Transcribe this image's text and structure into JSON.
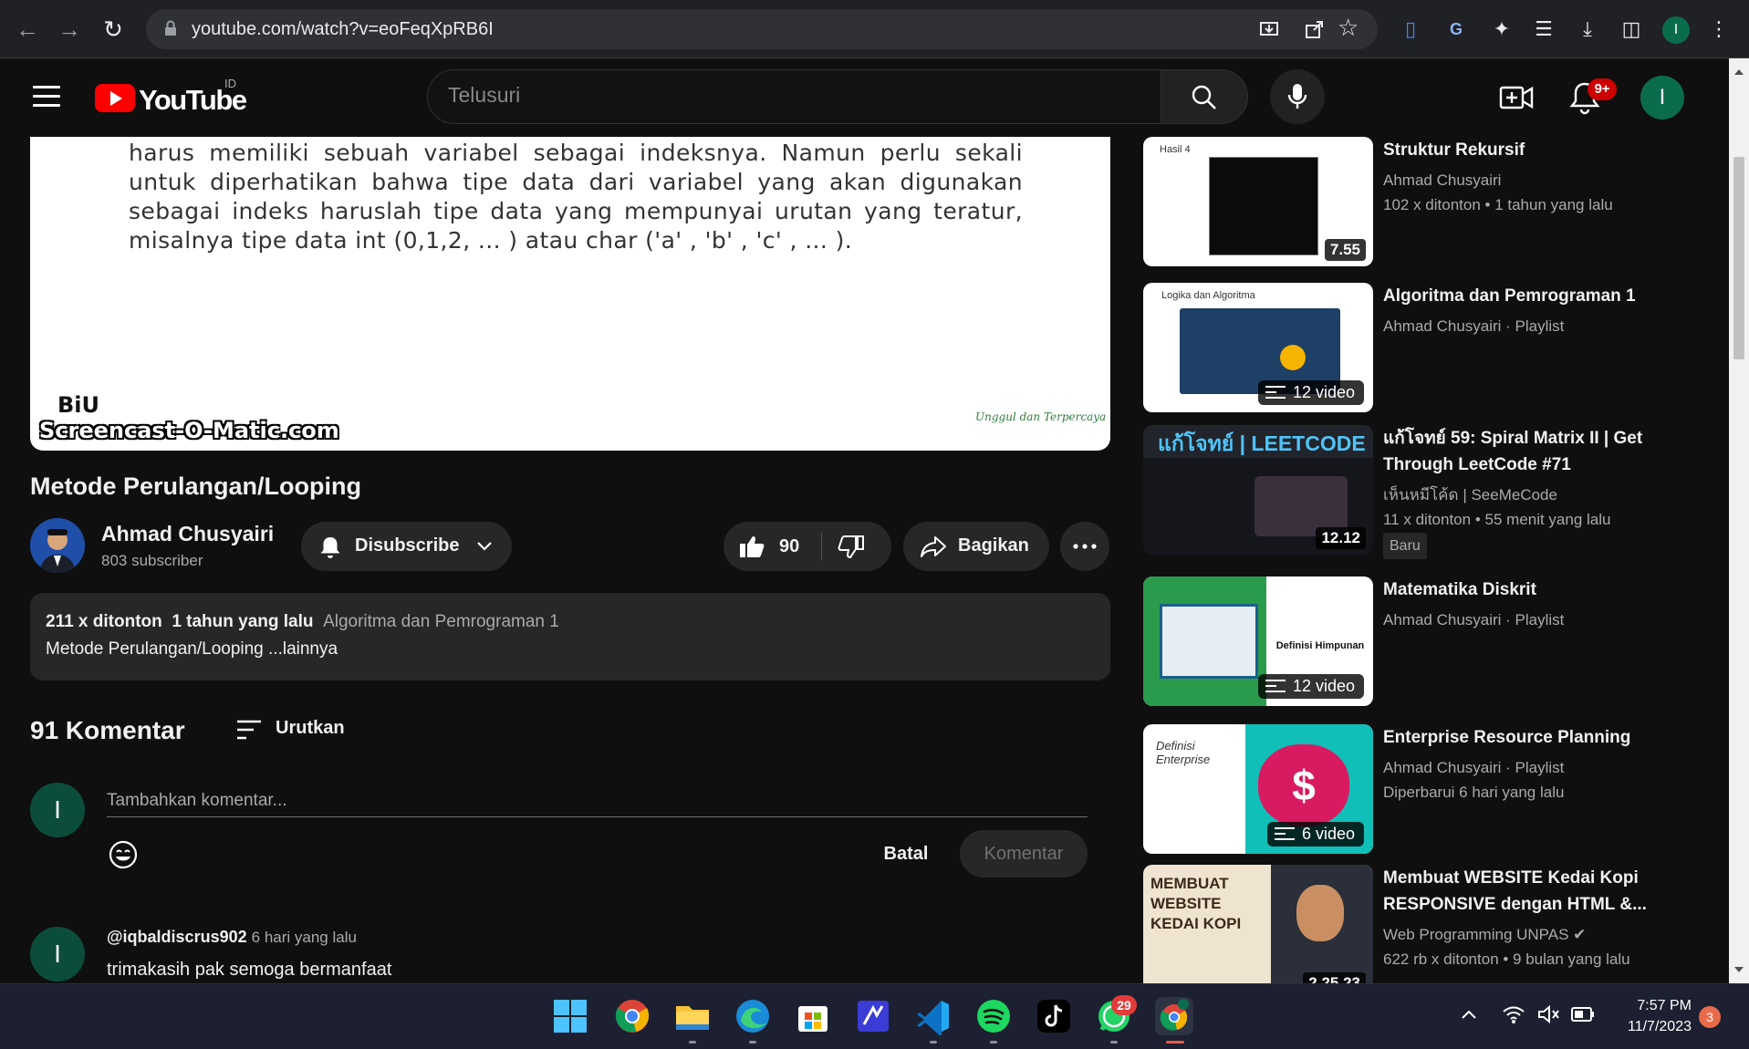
{
  "browser": {
    "url": "youtube.com/watch?v=eoFeqXpRB6I",
    "profile_initial": "I"
  },
  "header": {
    "logo_text": "YouTube",
    "region_code": "ID",
    "search_placeholder": "Telusuri",
    "notification_count": "9+",
    "avatar_initial": "I"
  },
  "video": {
    "slide_text": "harus memiliki sebuah variabel sebagai indeksnya. Namun perlu sekali untuk diperhatikan bahwa tipe data dari variabel yang akan digunakan sebagai indeks haruslah tipe data yang mempunyai urutan yang teratur, misalnya tipe data int (0,1,2, ... ) atau char ('a' , 'b' , 'c' , ... ).",
    "watermark_logo": "BiU",
    "watermark": "Screencast-O-Matic.com",
    "slide_logo": "Unggul dan Terpercaya",
    "title": "Metode Perulangan/Looping"
  },
  "channel": {
    "name": "Ahmad Chusyairi",
    "subscribers": "803 subscriber",
    "subscribe_label": "Disubscribe"
  },
  "actions": {
    "like_count": "90",
    "share_label": "Bagikan"
  },
  "description": {
    "views": "211 x ditonton",
    "age": "1 tahun yang lalu",
    "playlist": "Algoritma dan Pemrograman 1",
    "summary": "Metode Perulangan/Looping ...lainnya"
  },
  "comments": {
    "count_label": "91 Komentar",
    "sort_label": "Urutkan",
    "user_initial": "I",
    "input_placeholder": "Tambahkan komentar...",
    "cancel_label": "Batal",
    "submit_label": "Komentar",
    "items": [
      {
        "author": "@iqbaldiscrus902",
        "time": "6 hari yang lalu",
        "text": "trimakasih pak semoga bermanfaat",
        "initial": "I"
      }
    ]
  },
  "recommendations": [
    {
      "title": "Struktur Rekursif",
      "channel": "Ahmad Chusyairi",
      "meta": "102 x ditonton  • 1 tahun yang lalu",
      "duration": "7.55",
      "thumb_label": "Hasil 4"
    },
    {
      "title": "Algoritma dan Pemrograman 1",
      "channel": "Ahmad Chusyairi · Playlist",
      "badge": "12 video",
      "thumb_label": "Logika dan Algoritma"
    },
    {
      "title": "แก้โจทย์ 59: Spiral Matrix II | Get Through LeetCode #71",
      "channel": "เห็นหมีโค้ด | SeeMeCode",
      "meta": "11 x ditonton  • 55 menit yang lalu",
      "new_badge": "Baru",
      "duration": "12.12",
      "thumb_label": "แก้โจทย์ | LEETCODE"
    },
    {
      "title": "Matematika Diskrit",
      "channel": "Ahmad Chusyairi · Playlist",
      "badge": "12 video",
      "thumb_label": "Definisi Himpunan"
    },
    {
      "title": "Enterprise Resource Planning",
      "channel": "Ahmad Chusyairi · Playlist",
      "meta": "Diperbarui 6 hari yang lalu",
      "badge": "6 video",
      "thumb_label": "Definisi Enterprise"
    },
    {
      "title": "Membuat WEBSITE Kedai Kopi RESPONSIVE dengan HTML &...",
      "channel": "Web Programming UNPAS",
      "meta": "622 rb x ditonton  • 9 bulan yang lalu",
      "duration": "2.25.23",
      "thumb_label": "MEMBUAT WEBSITE KEDAI KOPI"
    }
  ],
  "taskbar": {
    "time": "7:57 PM",
    "date": "11/7/2023",
    "whatsapp_badge": "29",
    "notification_count": "3"
  },
  "colors": {
    "background": "#0f0f0f",
    "surface": "#272727",
    "brand_red": "#ff0000",
    "text": "#f1f1f1",
    "muted": "#aaaaaa"
  }
}
